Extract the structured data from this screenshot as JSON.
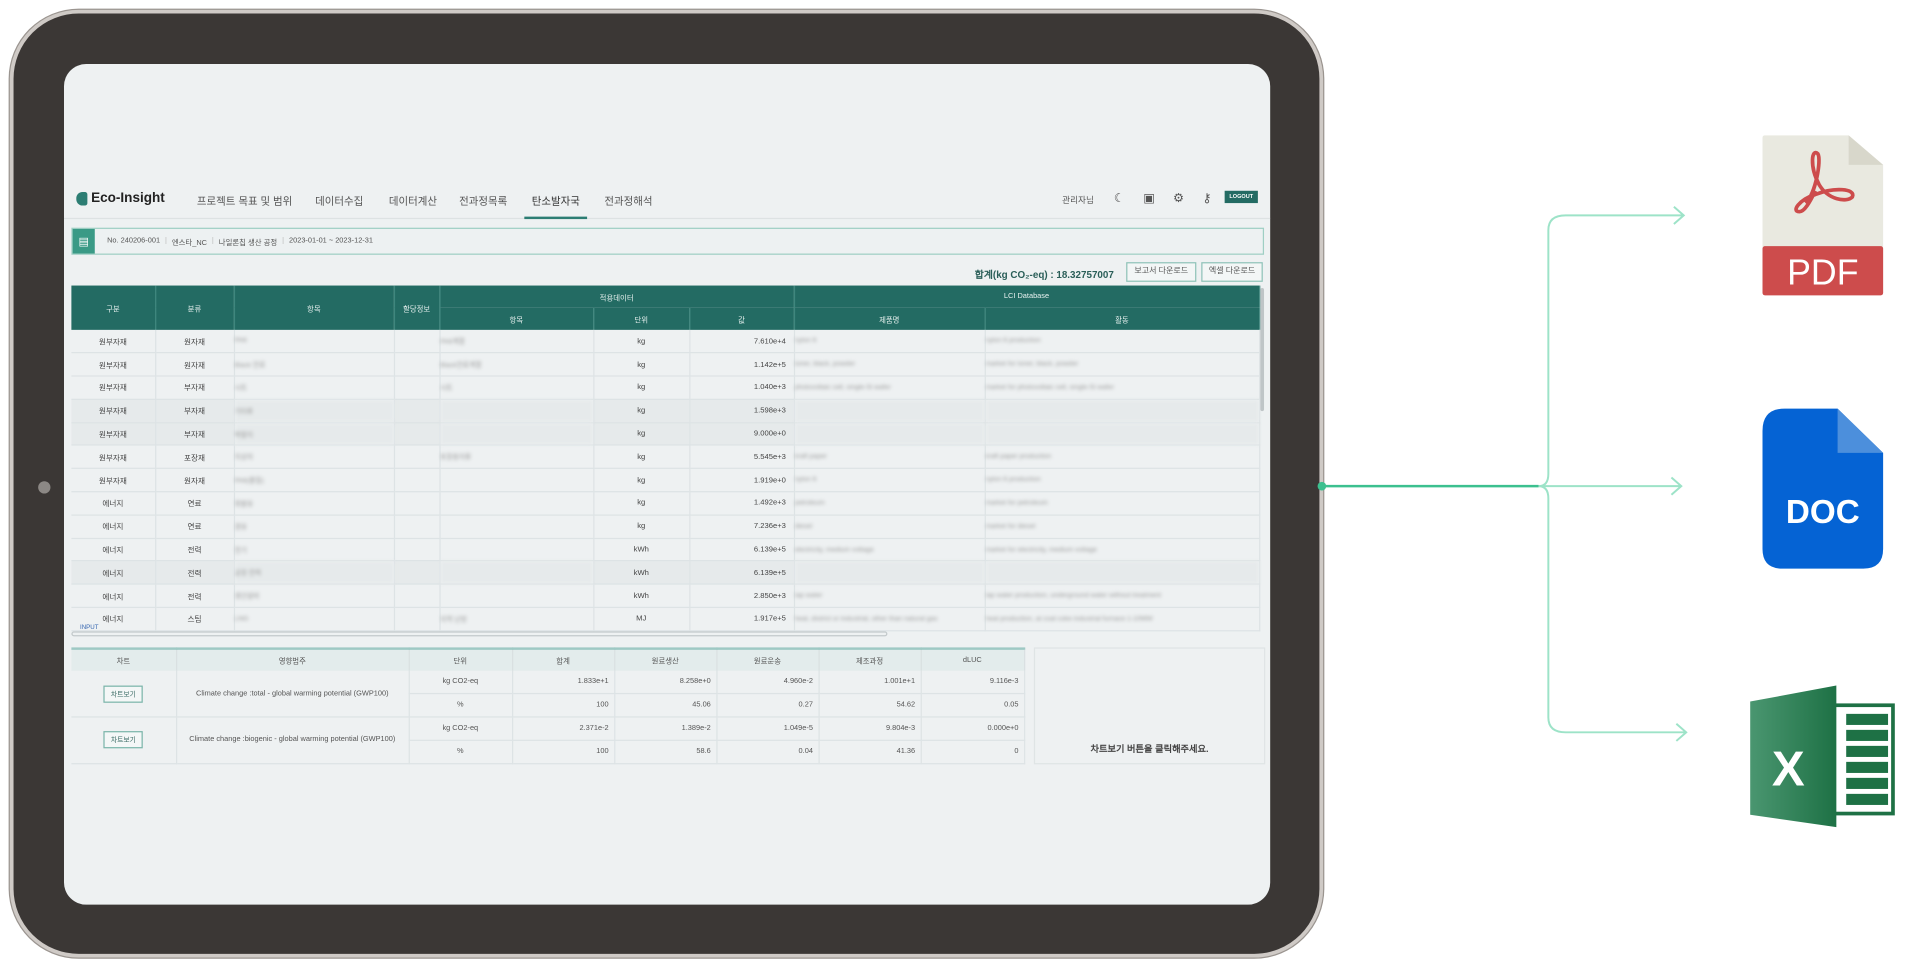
{
  "nav": {
    "logo": "Eco-Insight",
    "items": [
      "프로젝트 목표 및 범위",
      "데이터수집",
      "데이터계산",
      "전과정목록",
      "탄소발자국",
      "전과정해석"
    ],
    "active_index": 4,
    "user": "관리자님",
    "logout": "LOGOUT"
  },
  "info": {
    "no": "No. 240206-001",
    "company": "엔스타_NC",
    "process": "나일론칩 생산 공정",
    "period": "2023-01-01 ~ 2023-12-31"
  },
  "summary": {
    "total": "합계(kg CO₂-eq) : 18.32757007",
    "report_download": "보고서 다운로드",
    "excel_download": "엑셀 다운로드"
  },
  "inventory": {
    "headers": {
      "category": "구분",
      "class": "분류",
      "item": "항목",
      "allocation": "할당정보",
      "applied": "적용데이터",
      "applied_item": "항목",
      "unit": "단위",
      "value": "값",
      "lci": "LCI Database",
      "product": "제품명",
      "activity": "활동"
    },
    "rows": [
      [
        "원부자재",
        "원자재",
        "PA6",
        "PA6계열",
        "kg",
        "7.610e+4",
        "nylon 6",
        "nylon 6 production"
      ],
      [
        "원부자재",
        "원자재",
        "Black 안료",
        "Black안료계열",
        "kg",
        "1.142e+5",
        "toner, black, powder",
        "market for toner, black, powder"
      ],
      [
        "원부자재",
        "부자재",
        "시트",
        "시트",
        "kg",
        "1.040e+3",
        "photovoltaic cell, single-Si wafer",
        "market for photovoltaic cell, single-Si wafer"
      ],
      [
        "원부자재",
        "부자재",
        "기타류",
        "",
        "kg",
        "1.598e+3",
        "",
        ""
      ],
      [
        "원부자재",
        "부자재",
        "박말지",
        "",
        "kg",
        "9.000e+0",
        "",
        ""
      ],
      [
        "원부자재",
        "포장재",
        "지상자",
        "포장용지류",
        "kg",
        "5.545e+3",
        "kraft paper",
        "kraft paper production"
      ],
      [
        "원부자재",
        "원자재",
        "PA6(물질)",
        "",
        "kg",
        "1.919e+0",
        "nylon 6",
        "nylon 6 production"
      ],
      [
        "에너지",
        "연료",
        "휘발유",
        "",
        "kg",
        "1.492e+3",
        "petroleum",
        "market for petroleum"
      ],
      [
        "에너지",
        "연료",
        "경유",
        "",
        "kg",
        "7.236e+3",
        "diesel",
        "market for diesel"
      ],
      [
        "에너지",
        "전력",
        "전기",
        "",
        "kWh",
        "6.139e+5",
        "electricity, medium voltage",
        "market for electricity, medium voltage"
      ],
      [
        "에너지",
        "전력",
        "공장 전력",
        "",
        "kWh",
        "6.139e+5",
        "",
        ""
      ],
      [
        "에너지",
        "전력",
        "생산설비",
        "",
        "kWh",
        "2.850e+3",
        "tap water",
        "tap water production, underground water without treatment"
      ],
      [
        "에너지",
        "스팀",
        "LNG",
        "지역 난방",
        "MJ",
        "1.917e+5",
        "heat, district or industrial, other than natural gas",
        "heat production, at coal coke industrial furnace 1-10MW"
      ]
    ],
    "section_label": "INPUT"
  },
  "results": {
    "headers": [
      "차트",
      "영향범주",
      "단위",
      "합계",
      "원료생산",
      "원료운송",
      "제조과정",
      "dLUC"
    ],
    "chart_button": "차트보기",
    "groups": [
      {
        "category": "Climate change :total - global warming potential (GWP100)",
        "rows": [
          [
            "kg CO2-eq",
            "1.833e+1",
            "8.258e+0",
            "4.960e-2",
            "1.001e+1",
            "9.116e-3"
          ],
          [
            "%",
            "100",
            "45.06",
            "0.27",
            "54.62",
            "0.05"
          ]
        ]
      },
      {
        "category": "Climate change :biogenic - global warming potential (GWP100)",
        "rows": [
          [
            "kg CO2-eq",
            "2.371e-2",
            "1.389e-2",
            "1.049e-5",
            "9.804e-3",
            "0.000e+0"
          ],
          [
            "%",
            "100",
            "58.6",
            "0.04",
            "41.36",
            "0"
          ]
        ]
      }
    ],
    "chart_hint": "차트보기 버튼을 클릭해주세요."
  },
  "exports": {
    "pdf": "PDF",
    "doc": "DOC",
    "excel": "X"
  },
  "colors": {
    "accent": "#236b63",
    "arrow": "#8fdcc0",
    "pdf": "#cd4c4c",
    "doc": "#0563d4",
    "excel": "#1e7145"
  }
}
